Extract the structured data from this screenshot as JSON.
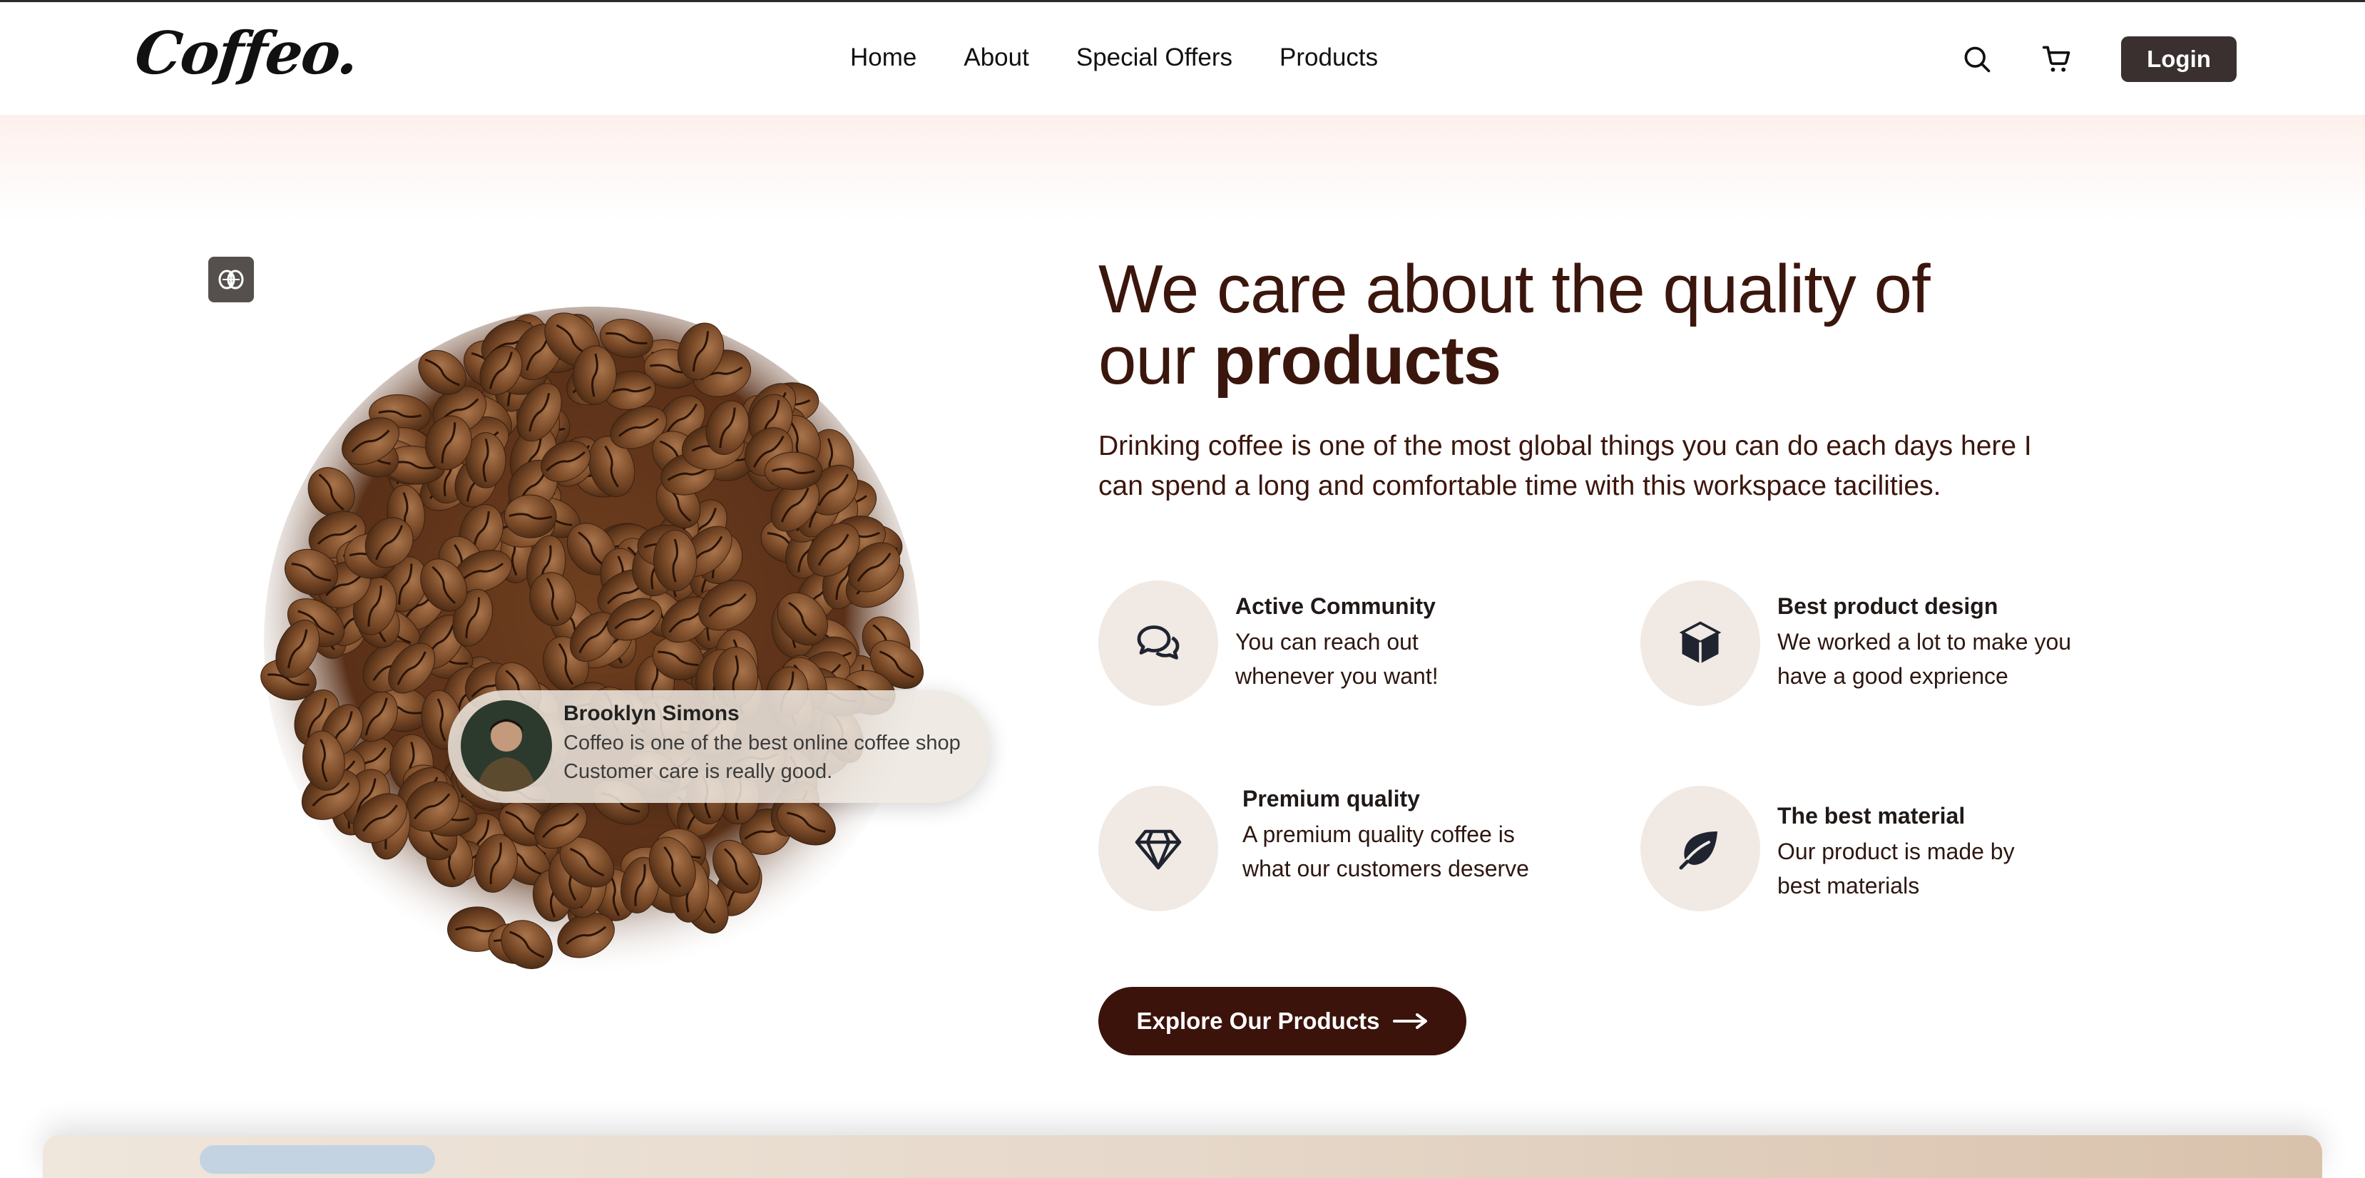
{
  "header": {
    "logo": "Coffeo.",
    "nav": [
      "Home",
      "About",
      "Special Offers",
      "Products"
    ],
    "search_icon": "search-icon",
    "cart_icon": "cart-icon",
    "login_label": "Login"
  },
  "hero": {
    "headline_line1": "We care about the quality of",
    "headline_line2_regular": "our",
    "headline_line2_bold": "products",
    "description": "Drinking coffee is one of the most global things you can do each days here I can spend a long and comfortable time with this workspace tacilities."
  },
  "review": {
    "name": "Brooklyn Simons",
    "line1": "Coffeo is one of the best online coffee shop",
    "line2": "Customer care is really good."
  },
  "features": [
    {
      "icon": "chat-bubbles-icon",
      "title": "Active Community",
      "desc": "You can reach out whenever you want!"
    },
    {
      "icon": "box-icon",
      "title": "Best product design",
      "desc": "We worked a lot to make you have a good exprience"
    },
    {
      "icon": "diamond-icon",
      "title": "Premium quality",
      "desc": "A premium quality coffee is what our customers deserve"
    },
    {
      "icon": "leaf-icon",
      "title": "The best material",
      "desc": "Our product is made by best materials"
    }
  ],
  "cta": {
    "label": "Explore Our Products",
    "icon": "arrow-right-icon"
  },
  "colors": {
    "brand": "#3b130b",
    "feature_bg": "#f1e9e3",
    "login_bg": "#3a3030"
  }
}
